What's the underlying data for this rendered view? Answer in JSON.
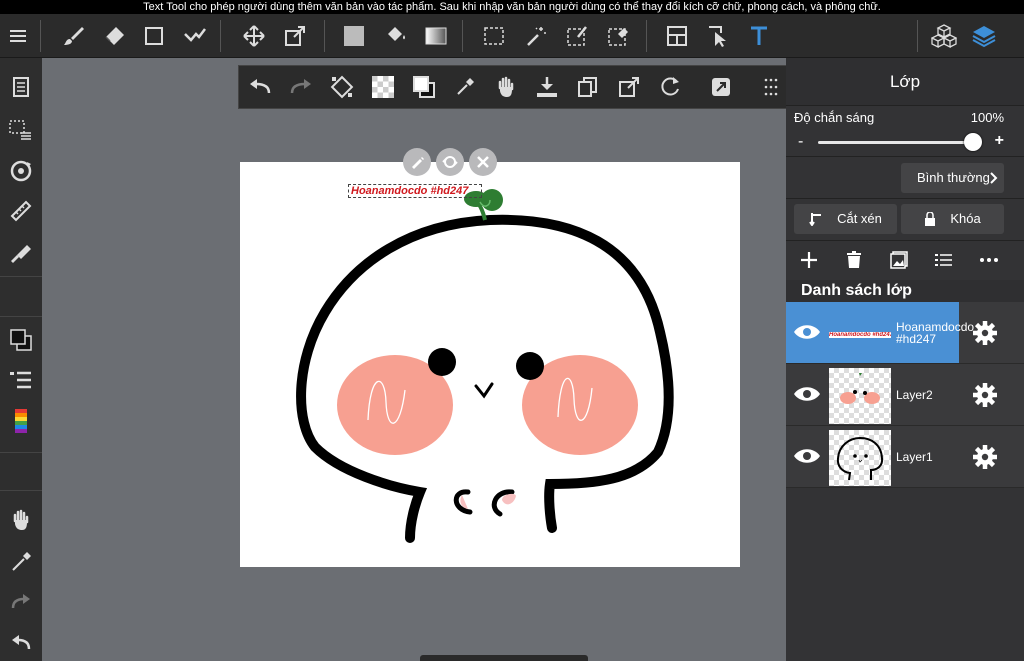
{
  "banner": {
    "text": "Text Tool cho phép người dùng thêm văn bản vào tác phẩm. Sau khi nhập văn bản người dùng có thể thay đổi kích cỡ chữ, phong cách, và phông chữ."
  },
  "canvas": {
    "text_object": "Hoanamdocdo #hd247"
  },
  "panel": {
    "title": "Lớp",
    "opacity_label": "Độ chắn sáng",
    "opacity_value": "100%",
    "opacity_level": 1.0,
    "minus": "-",
    "plus": "+",
    "blend_mode": "Bình thường",
    "clip_label": "Cắt xén",
    "lock_label": "Khóa",
    "list_header": "Danh sách lớp",
    "layers": [
      {
        "name": "Hoanamdocdo #hd247",
        "selected": true,
        "thumb_text": "Hoanamdocdo #hd247"
      },
      {
        "name": "Layer2",
        "selected": false
      },
      {
        "name": "Layer1",
        "selected": false
      }
    ]
  },
  "colors": {
    "accent": "#4a90d4",
    "text_tool": "#3d8fd8",
    "text_color": "#d0191e",
    "blush": "#f7a091"
  }
}
